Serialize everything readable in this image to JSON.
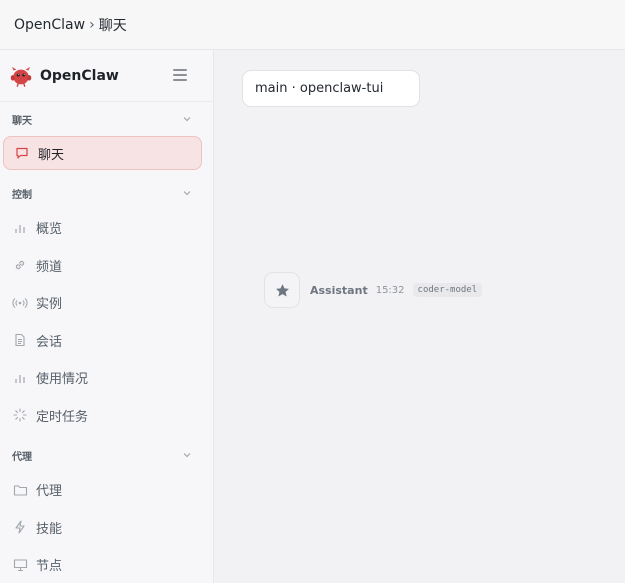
{
  "breadcrumb": {
    "root": "OpenClaw",
    "separator": "›",
    "current": "聊天"
  },
  "brand": {
    "name": "OpenClaw",
    "color": "#d64545"
  },
  "sidebar": {
    "sections": [
      {
        "label": "聊天",
        "items": [
          {
            "label": "聊天",
            "icon": "chat-bubble-icon",
            "active": true
          }
        ]
      },
      {
        "label": "控制",
        "items": [
          {
            "label": "概览",
            "icon": "bar-chart-icon"
          },
          {
            "label": "频道",
            "icon": "link-icon"
          },
          {
            "label": "实例",
            "icon": "broadcast-icon"
          },
          {
            "label": "会话",
            "icon": "document-icon"
          },
          {
            "label": "使用情况",
            "icon": "bar-chart-icon"
          },
          {
            "label": "定时任务",
            "icon": "loader-icon"
          }
        ]
      },
      {
        "label": "代理",
        "items": [
          {
            "label": "代理",
            "icon": "folder-icon"
          },
          {
            "label": "技能",
            "icon": "lightning-icon"
          },
          {
            "label": "节点",
            "icon": "monitor-icon"
          }
        ]
      }
    ]
  },
  "main": {
    "session": "main · openclaw-tui",
    "message": {
      "sender": "Assistant",
      "time": "15:32",
      "model": "coder-model",
      "avatar_icon": "star-icon"
    }
  },
  "colors": {
    "accent": "#d64545",
    "active_bg": "#f7e3e3",
    "active_border": "#ecc3c3"
  }
}
